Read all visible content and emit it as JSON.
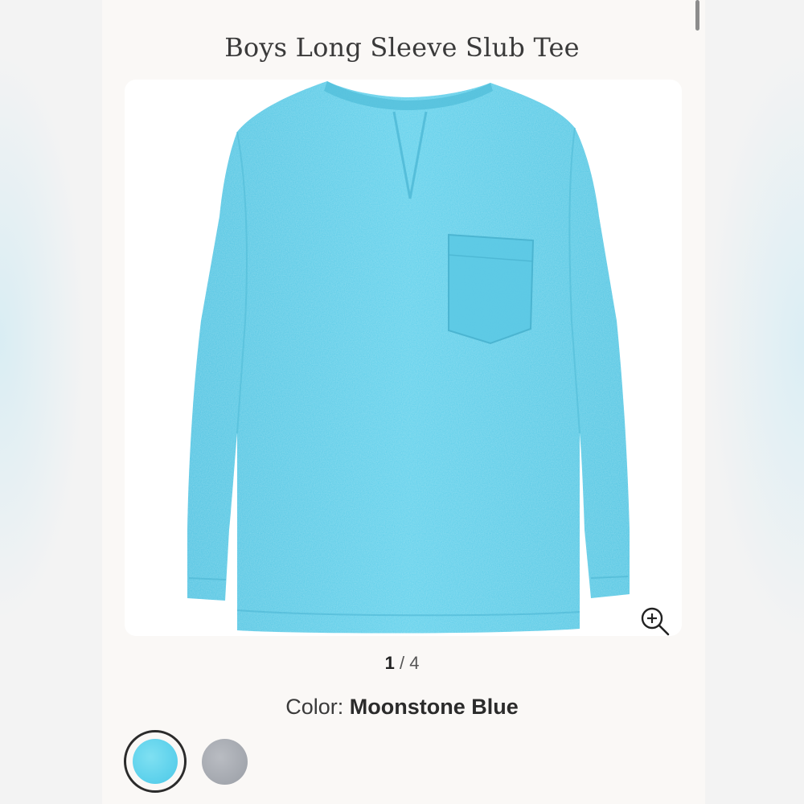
{
  "header": {
    "title": "Boys Long Sleeve Slub Tee"
  },
  "gallery": {
    "current": "1",
    "separator": "/",
    "total": "4",
    "zoom_icon": "zoom-in-icon"
  },
  "color_selector": {
    "label": "Color:",
    "selected": "Moonstone Blue",
    "swatches": [
      {
        "color": "#5fd2ec",
        "selected": true
      },
      {
        "color": "#a3a7ae",
        "selected": false
      }
    ]
  },
  "colors": {
    "tee": "#62cfea",
    "background": "#faf8f6"
  }
}
